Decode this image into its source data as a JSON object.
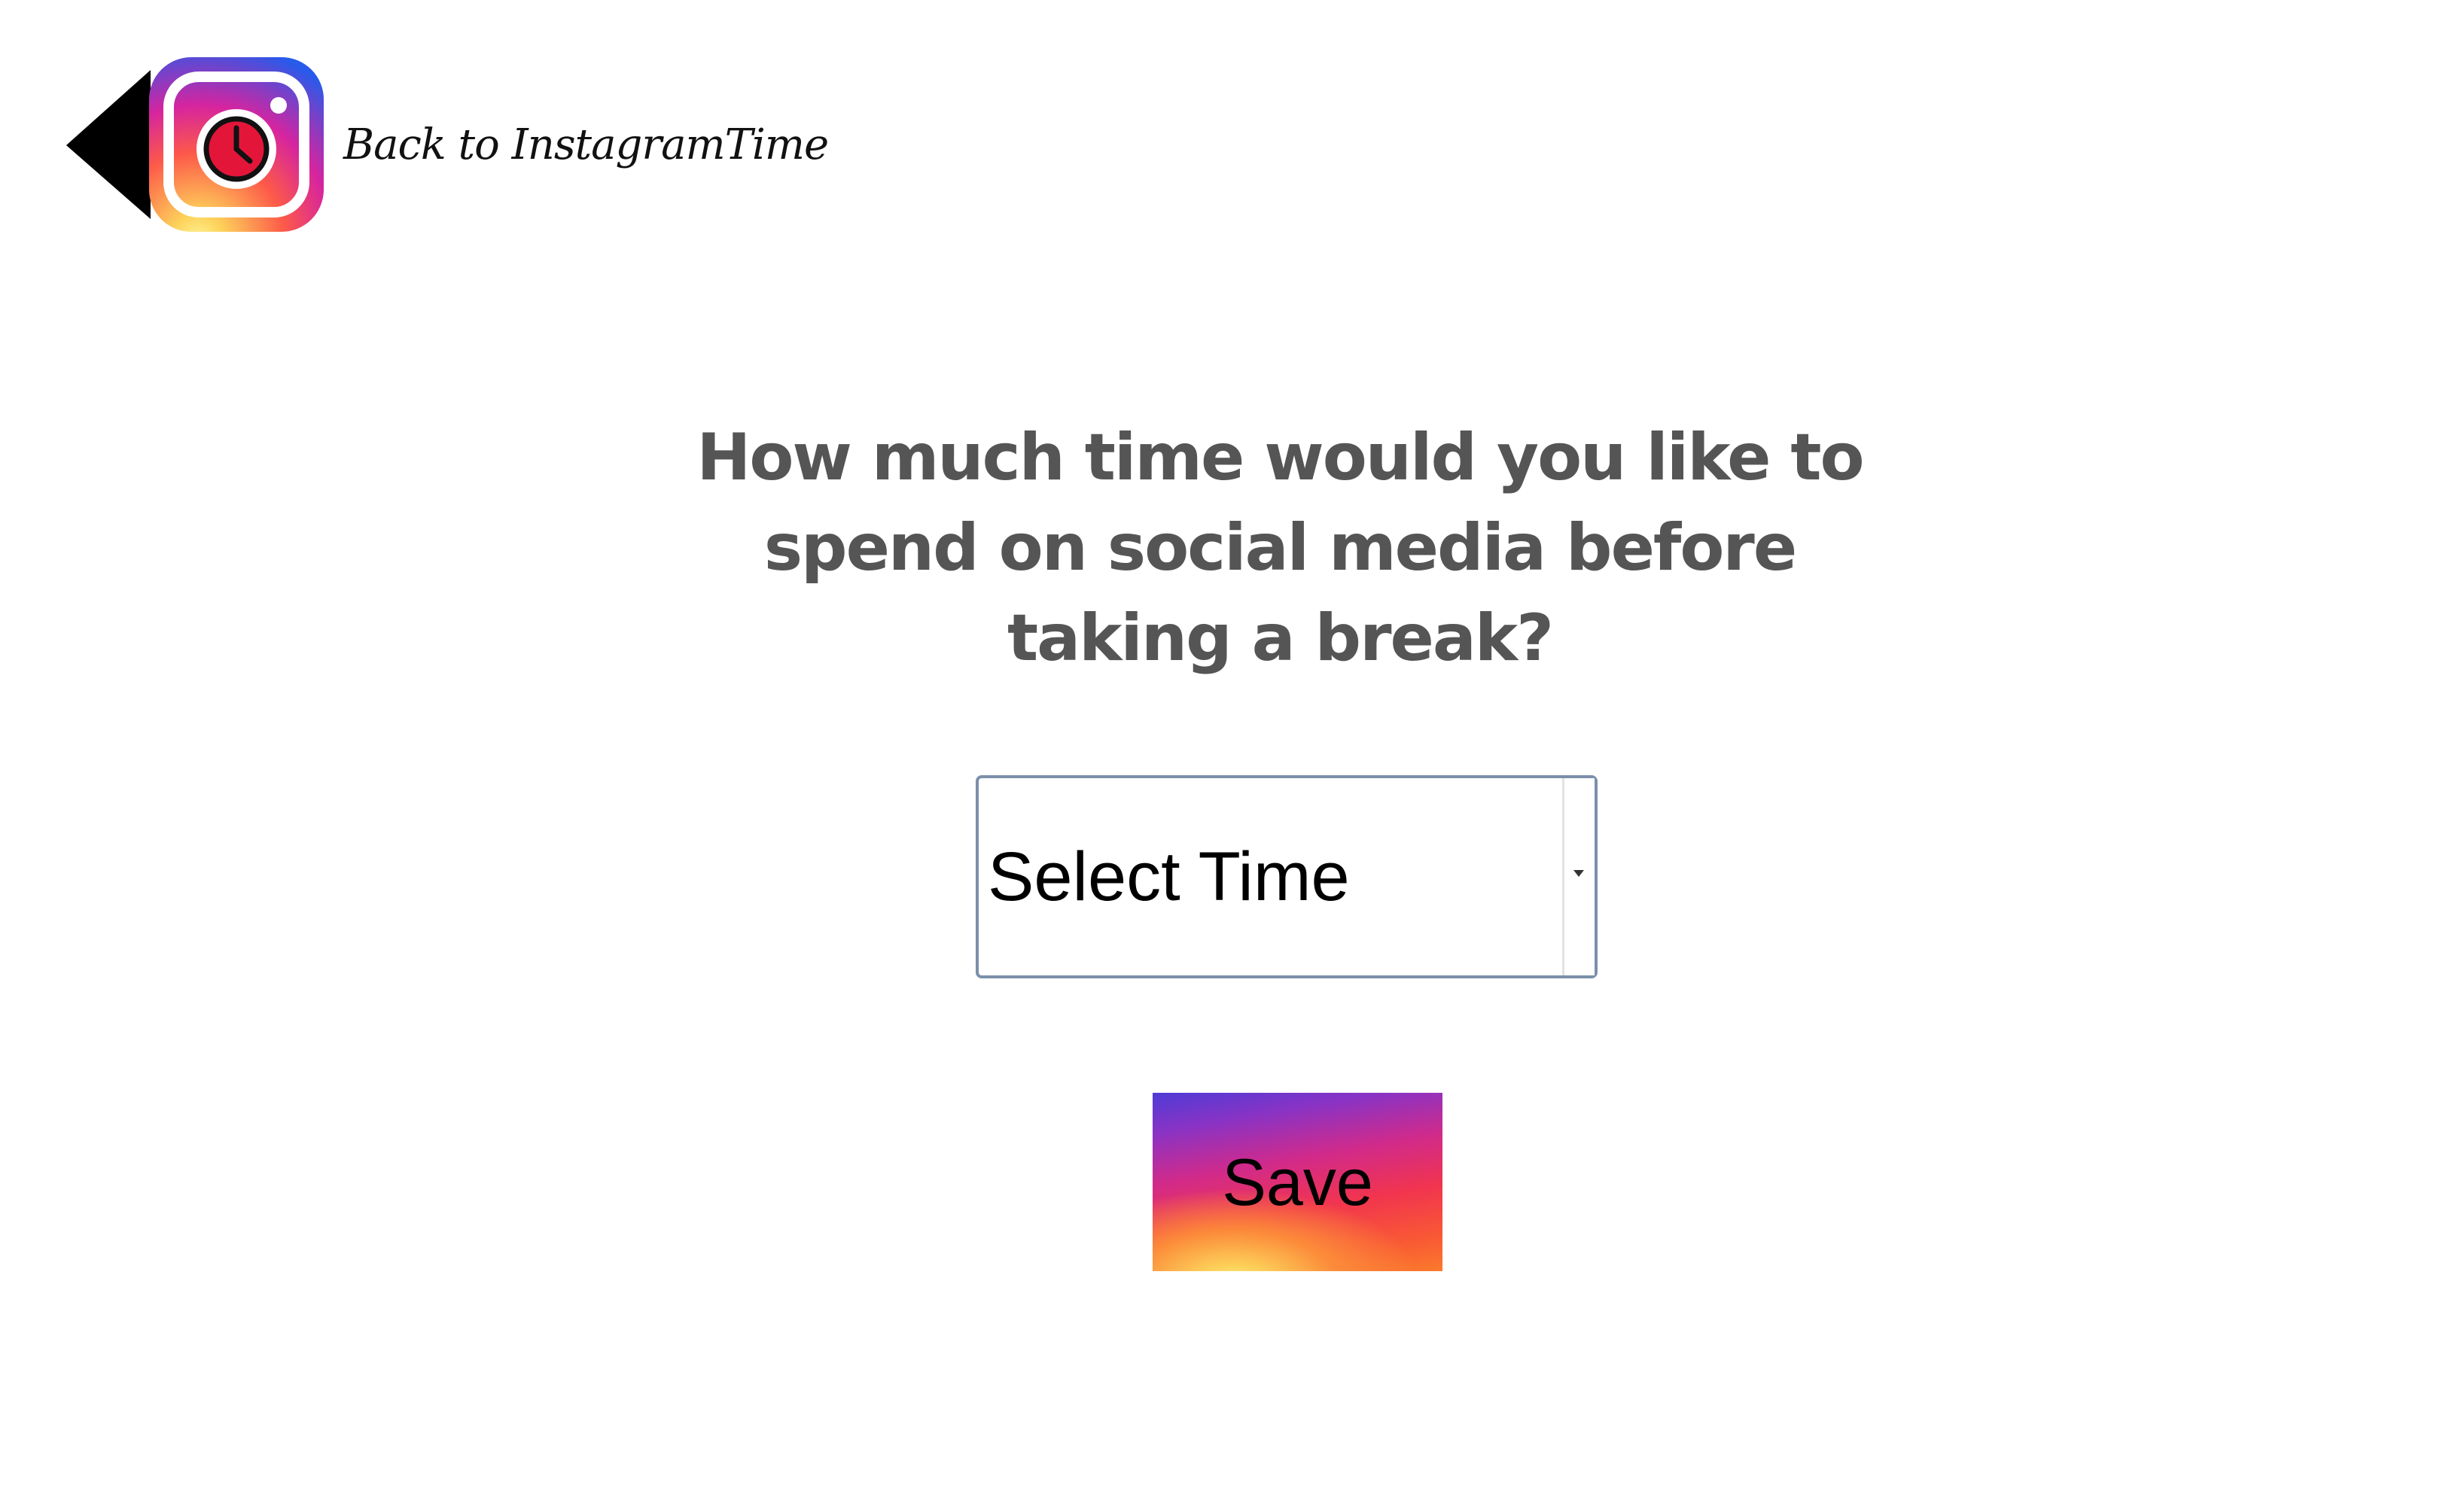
{
  "header": {
    "back_label": "Back to InstagramTime",
    "logo_icon": "instagram-clock-logo-icon",
    "back_icon": "back-arrow-icon"
  },
  "main": {
    "question": "How much time would you like to spend on social media before taking a break?",
    "time_select": {
      "selected_value": "Select Time",
      "icon": "dropdown-arrow-icon"
    },
    "save_label": "Save"
  },
  "colors": {
    "text_question": "#555555",
    "select_border": "#7b8faa",
    "gradient_purple": "#4f3bd6",
    "gradient_magenta": "#d12a8a",
    "gradient_red": "#f1344f",
    "gradient_orange": "#fb7a2c",
    "gradient_yellow": "#fdd25a"
  }
}
